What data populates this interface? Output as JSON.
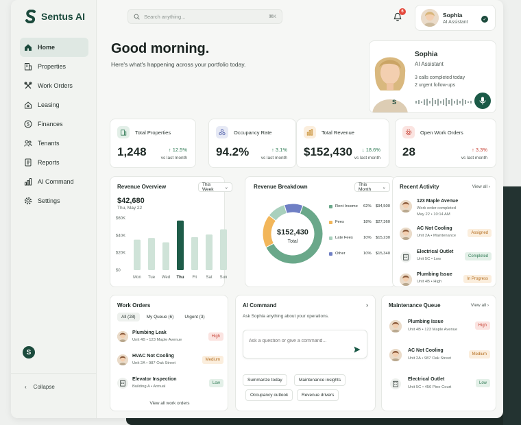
{
  "app": {
    "name": "Sentus AI"
  },
  "sidebar": {
    "items": [
      {
        "label": "Home",
        "icon": "home-icon"
      },
      {
        "label": "Properties",
        "icon": "building-icon"
      },
      {
        "label": "Work Orders",
        "icon": "wrench-icon"
      },
      {
        "label": "Leasing",
        "icon": "house-key-icon"
      },
      {
        "label": "Finances",
        "icon": "dollar-icon"
      },
      {
        "label": "Tenants",
        "icon": "users-icon"
      },
      {
        "label": "Reports",
        "icon": "report-icon"
      },
      {
        "label": "AI Command",
        "icon": "bar-chart-icon"
      },
      {
        "label": "Settings",
        "icon": "gear-icon"
      }
    ],
    "collapse_label": "Collapse"
  },
  "search": {
    "placeholder": "Search anything...",
    "shortcut": "⌘K"
  },
  "notifications": {
    "count": "6"
  },
  "user": {
    "name": "Sophia",
    "role": "AI Assistant"
  },
  "greeting": {
    "title": "Good morning.",
    "subtitle": "Here's what's happening across your portfolio today."
  },
  "assistant": {
    "name": "Sophia",
    "role": "AI Assistant",
    "line1": "3 calls completed today",
    "line2": "2 urgent follow-ups"
  },
  "kpis": [
    {
      "label": "Total Properties",
      "value": "1,248",
      "change": "↑ 12.5%",
      "vs": "vs last month",
      "color": "#2f7a54",
      "bg": "#e3efe8",
      "icon": "building-icon"
    },
    {
      "label": "Occupancy Rate",
      "value": "94.2%",
      "change": "↑ 3.1%",
      "vs": "vs last month",
      "color": "#2f7a54",
      "bg": "#e6e9f5",
      "icon": "people-icon"
    },
    {
      "label": "Total Revenue",
      "value": "$152,430",
      "change": "↓ 18.6%",
      "vs": "vs last month",
      "color": "#2f7a54",
      "bg": "#fbeedd",
      "icon": "chart-icon"
    },
    {
      "label": "Open Work Orders",
      "value": "28",
      "change": "↑ 3.3%",
      "vs": "vs last month",
      "color": "#c8463a",
      "bg": "#fbe4e1",
      "icon": "gear-icon"
    }
  ],
  "revenue_overview": {
    "title": "Revenue Overview",
    "period": "This Week",
    "headline": "$42,680",
    "date": "Thu, May 22"
  },
  "chart_data": {
    "type": "bar",
    "categories": [
      "Mon",
      "Tue",
      "Wed",
      "Thu",
      "Fri",
      "Sat",
      "Sun"
    ],
    "values": [
      35000,
      37000,
      32000,
      57000,
      38000,
      41000,
      47000
    ],
    "yticks": [
      "$0",
      "$20K",
      "$40K",
      "$60K"
    ],
    "ylim": [
      0,
      60000
    ],
    "highlight": "Thu"
  },
  "revenue_breakdown": {
    "title": "Revenue Breakdown",
    "period": "This Month",
    "total": "$152,430",
    "total_label": "Total",
    "items": [
      {
        "name": "Rent Income",
        "pct": "62%",
        "amount": "$94,500",
        "value": 62,
        "color": "#6aa88a"
      },
      {
        "name": "Fees",
        "pct": "18%",
        "amount": "$27,360",
        "value": 18,
        "color": "#f2b65a"
      },
      {
        "name": "Late Fees",
        "pct": "10%",
        "amount": "$15,230",
        "value": 10,
        "color": "#a9d0bd"
      },
      {
        "name": "Other",
        "pct": "10%",
        "amount": "$15,340",
        "value": 10,
        "color": "#6f7fc4"
      }
    ]
  },
  "recent_activity": {
    "title": "Recent Activity",
    "view_all": "View all",
    "items": [
      {
        "title": "123 Maple Avenue",
        "sub1": "Work order completed",
        "sub2": "May 22 • 10:14 AM",
        "badge": ""
      },
      {
        "title": "AC Not Cooling",
        "sub1": "Unit 2A • Maintenance",
        "badge": "Assigned"
      },
      {
        "title": "Electrical Outlet",
        "sub1": "Unit 5C • Low",
        "badge": "Completed"
      },
      {
        "title": "Plumbing Issue",
        "sub1": "Unit 4B • High",
        "badge": "In Progress"
      }
    ]
  },
  "work_orders": {
    "title": "Work Orders",
    "tabs": [
      "All (28)",
      "My Queue (6)",
      "Urgent (3)"
    ],
    "items": [
      {
        "title": "Plumbing Leak",
        "sub": "Unit 4B • 123 Maple Avenue",
        "badge": "High"
      },
      {
        "title": "HVAC Not Cooling",
        "sub": "Unit 2A • 987 Oak Street",
        "badge": "Medium"
      },
      {
        "title": "Elevator Inspection",
        "sub": "Building A • Annual",
        "badge": "Low"
      }
    ],
    "view_all": "View all work orders"
  },
  "ai_command": {
    "title": "AI Command",
    "subtitle": "Ask Sophia anything about your operations.",
    "placeholder": "Ask a question or give a command...",
    "chips": [
      "Summarize today",
      "Maintenance insights",
      "Occupancy outlook",
      "Revenue drivers"
    ]
  },
  "maintenance": {
    "title": "Maintenance Queue",
    "view_all": "View all",
    "items": [
      {
        "title": "Plumbing Issue",
        "sub": "Unit 4B • 123 Maple Avenue",
        "badge": "High"
      },
      {
        "title": "AC Not Cooling",
        "sub": "Unit 2A • 987 Oak Street",
        "badge": "Medium"
      },
      {
        "title": "Electrical Outlet",
        "sub": "Unit 5C • 456 Pine Court",
        "badge": "Low"
      }
    ]
  }
}
